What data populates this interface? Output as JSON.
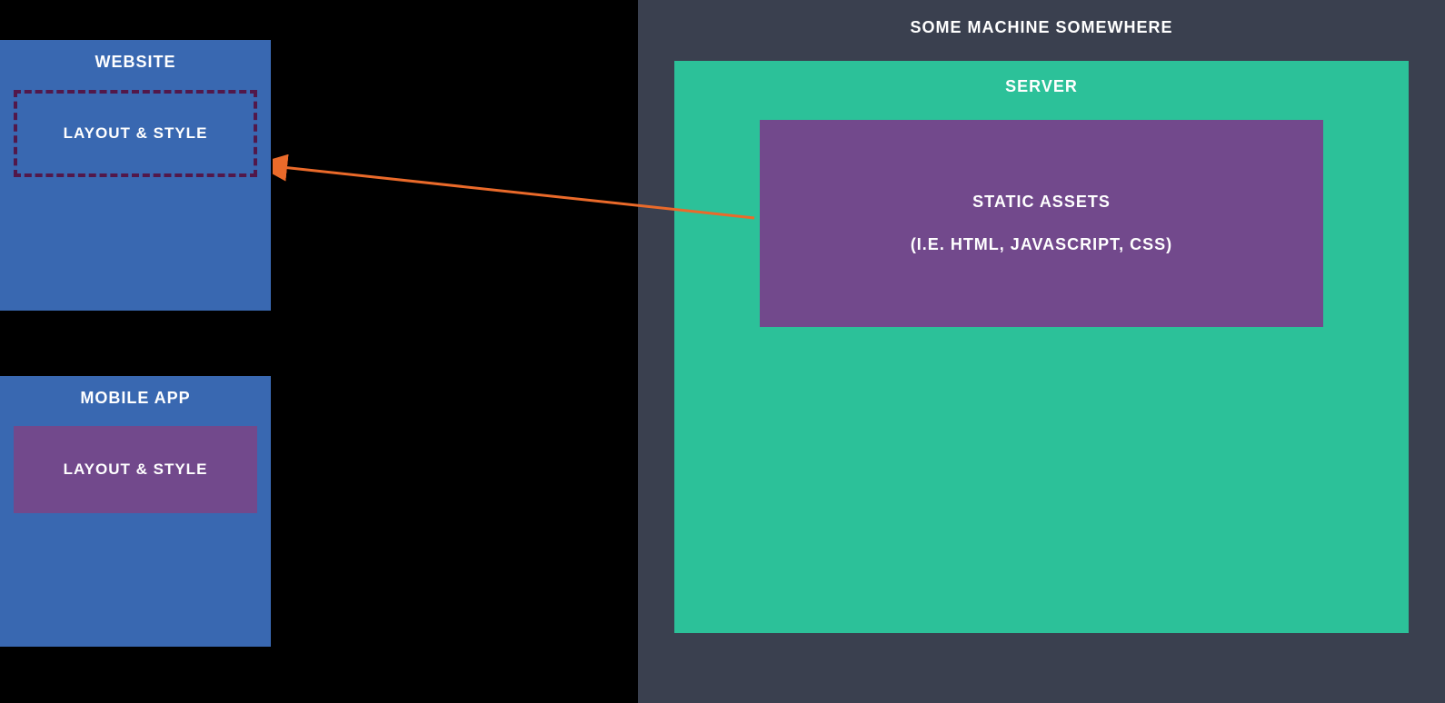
{
  "left": {
    "website": {
      "title": "WEBSITE",
      "layout_style_label": "LAYOUT & STYLE"
    },
    "mobile_app": {
      "title": "MOBILE APP",
      "layout_style_label": "LAYOUT & STYLE"
    }
  },
  "right": {
    "machine": {
      "title": "SOME MACHINE SOMEWHERE"
    },
    "server": {
      "title": "SERVER"
    },
    "static_assets": {
      "title": "STATIC ASSETS",
      "subtitle": "(I.E. HTML, JAVASCRIPT, CSS)"
    }
  },
  "colors": {
    "background": "#000000",
    "box_blue": "#3968b1",
    "box_purple": "#72498c",
    "box_teal": "#2cc199",
    "box_dark": "#3a404f",
    "dashed_border": "#52184a",
    "arrow": "#ea6a2a"
  }
}
